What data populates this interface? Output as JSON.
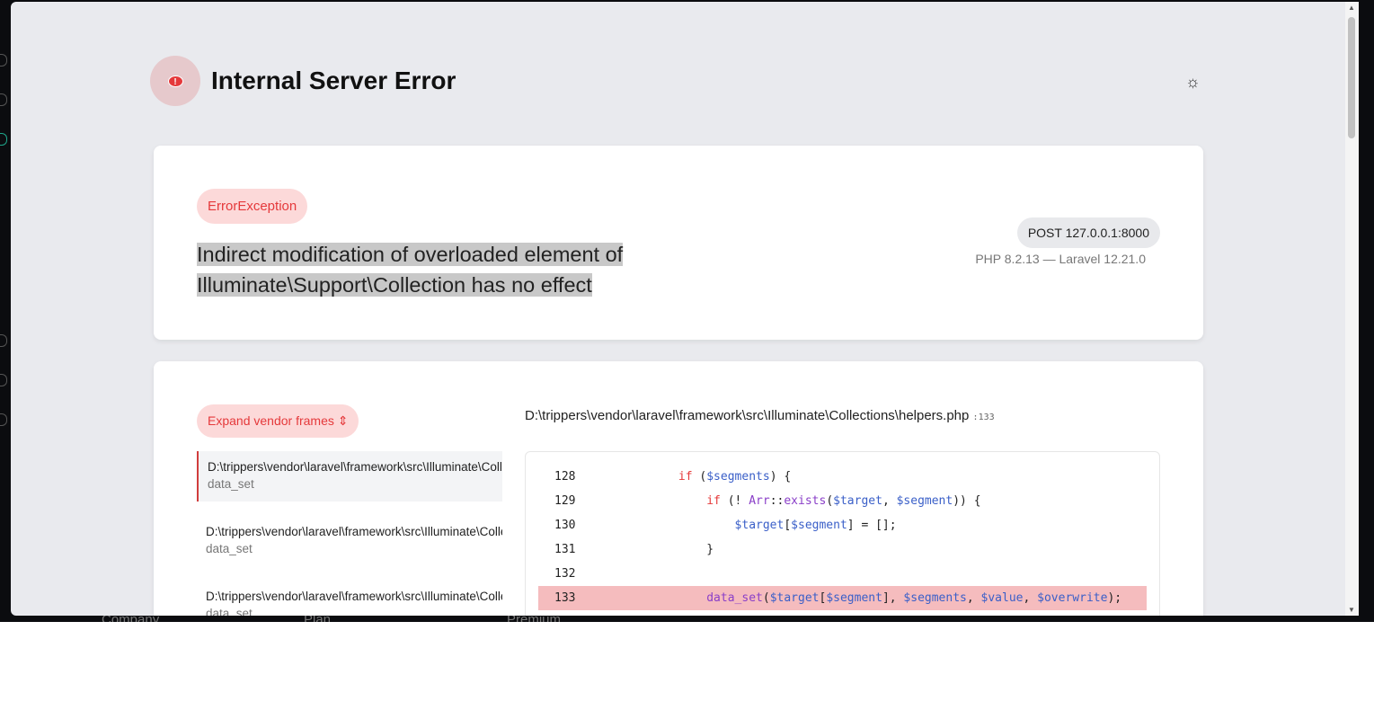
{
  "page": {
    "title": "Internal Server Error",
    "theme_icon": "sun-icon"
  },
  "exception": {
    "type": "ErrorException",
    "message": "Indirect modification of overloaded element of Illuminate\\Support\\Collection has no effect",
    "request": "POST 127.0.0.1:8000",
    "versions": "PHP 8.2.13 — Laravel 12.21.0"
  },
  "trace": {
    "expand_label": "Expand vendor frames",
    "expand_icon": "⌃⌄",
    "frames": [
      {
        "path": "D:\\trippers\\vendor\\laravel\\framework\\src\\Illuminate\\Collections\\helpers.php",
        "func": "data_set"
      },
      {
        "path": "D:\\trippers\\vendor\\laravel\\framework\\src\\Illuminate\\Collections\\helpers.php",
        "func": "data_set"
      },
      {
        "path": "D:\\trippers\\vendor\\laravel\\framework\\src\\Illuminate\\Collections\\helpers.php",
        "func": "data_set"
      }
    ]
  },
  "code": {
    "file": "D:\\trippers\\vendor\\laravel\\framework\\src\\Illuminate\\Collections\\helpers.php",
    "line": ":133",
    "lines": [
      {
        "n": "128",
        "tokens": [
          [
            "t",
            "            "
          ],
          [
            "k",
            "if"
          ],
          [
            "t",
            " ("
          ],
          [
            "v",
            "$segments"
          ],
          [
            "t",
            ") {"
          ]
        ]
      },
      {
        "n": "129",
        "tokens": [
          [
            "t",
            "                "
          ],
          [
            "k",
            "if"
          ],
          [
            "t",
            " (! "
          ],
          [
            "fn",
            "Arr"
          ],
          [
            "t",
            "::"
          ],
          [
            "fn",
            "exists"
          ],
          [
            "t",
            "("
          ],
          [
            "v",
            "$target"
          ],
          [
            "t",
            ", "
          ],
          [
            "v",
            "$segment"
          ],
          [
            "t",
            ")) {"
          ]
        ]
      },
      {
        "n": "130",
        "tokens": [
          [
            "t",
            "                    "
          ],
          [
            "v",
            "$target"
          ],
          [
            "t",
            "["
          ],
          [
            "v",
            "$segment"
          ],
          [
            "t",
            "] = [];"
          ]
        ]
      },
      {
        "n": "131",
        "tokens": [
          [
            "t",
            "                }"
          ]
        ]
      },
      {
        "n": "132",
        "tokens": []
      },
      {
        "n": "133",
        "hl": true,
        "tokens": [
          [
            "t",
            "                "
          ],
          [
            "fn",
            "data_set"
          ],
          [
            "t",
            "("
          ],
          [
            "v",
            "$target"
          ],
          [
            "t",
            "["
          ],
          [
            "v",
            "$segment"
          ],
          [
            "t",
            "], "
          ],
          [
            "v",
            "$segments"
          ],
          [
            "t",
            ", "
          ],
          [
            "v",
            "$value"
          ],
          [
            "t",
            ", "
          ],
          [
            "v",
            "$overwrite"
          ],
          [
            "t",
            ");"
          ]
        ]
      }
    ]
  },
  "background": {
    "labels": [
      "Company",
      "Plan",
      "Premium"
    ]
  }
}
